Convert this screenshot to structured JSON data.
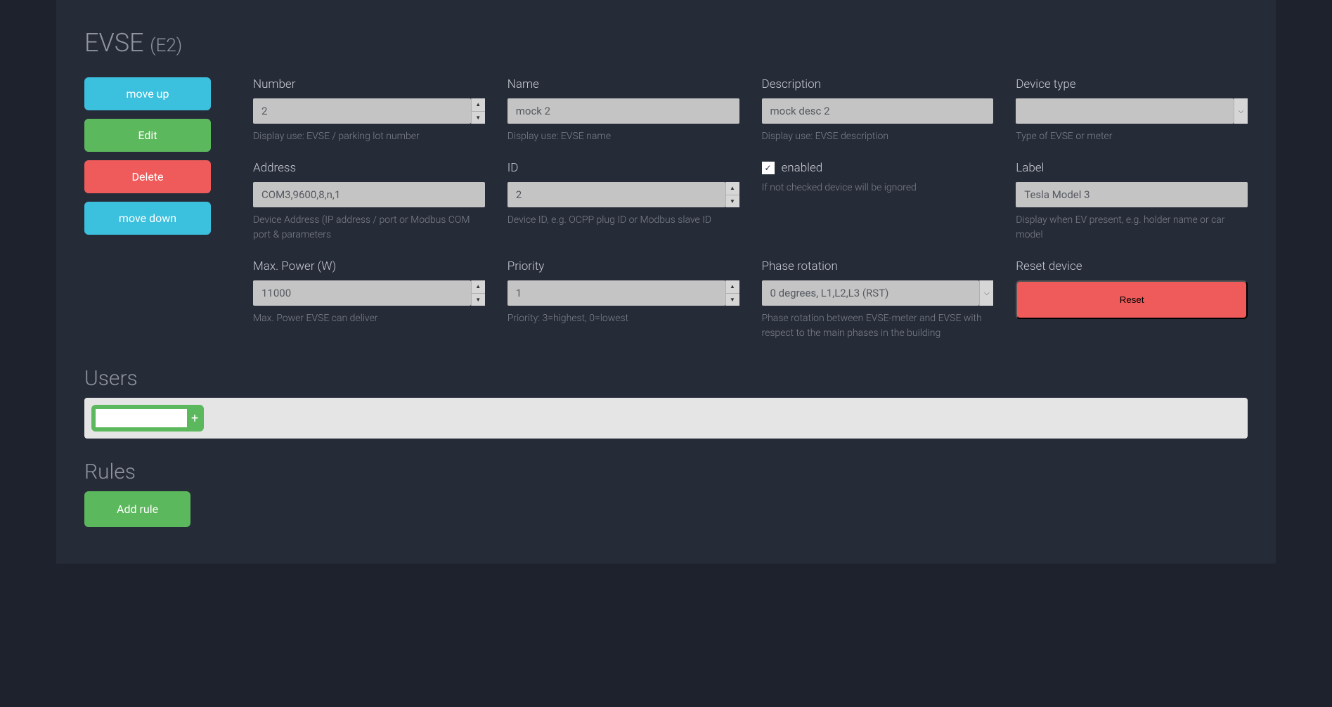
{
  "header": {
    "title": "EVSE",
    "subtitle": "(E2)"
  },
  "actions": {
    "move_up": "move up",
    "edit": "Edit",
    "delete": "Delete",
    "move_down": "move down"
  },
  "fields": {
    "number": {
      "label": "Number",
      "value": "2",
      "hint": "Display use: EVSE / parking lot number"
    },
    "name": {
      "label": "Name",
      "value": "mock 2",
      "hint": "Display use: EVSE name"
    },
    "description": {
      "label": "Description",
      "value": "mock desc 2",
      "hint": "Display use: EVSE description"
    },
    "device_type": {
      "label": "Device type",
      "value": "",
      "hint": "Type of EVSE or meter"
    },
    "address": {
      "label": "Address",
      "value": "COM3,9600,8,n,1",
      "hint": "Device Address (IP address / port or Modbus COM port & parameters"
    },
    "id": {
      "label": "ID",
      "value": "2",
      "hint": "Device ID, e.g. OCPP plug ID or Modbus slave ID"
    },
    "enabled": {
      "label": "enabled",
      "checked": true,
      "hint": "If not checked device will be ignored"
    },
    "label": {
      "label": "Label",
      "value": "Tesla Model 3",
      "hint": "Display when EV present, e.g. holder name or car model"
    },
    "max_power": {
      "label": "Max. Power (W)",
      "value": "11000",
      "hint": "Max. Power EVSE can deliver"
    },
    "priority": {
      "label": "Priority",
      "value": "1",
      "hint": "Priority: 3=highest, 0=lowest"
    },
    "phase_rotation": {
      "label": "Phase rotation",
      "value": "0 degrees, L1,L2,L3 (RST)",
      "hint": "Phase rotation between EVSE-meter and EVSE with respect to the main phases in the building"
    },
    "reset_device": {
      "label": "Reset device",
      "button": "Reset"
    }
  },
  "sections": {
    "users": "Users",
    "rules": "Rules"
  },
  "users": {
    "add_symbol": "+"
  },
  "rules": {
    "add_button": "Add rule"
  }
}
